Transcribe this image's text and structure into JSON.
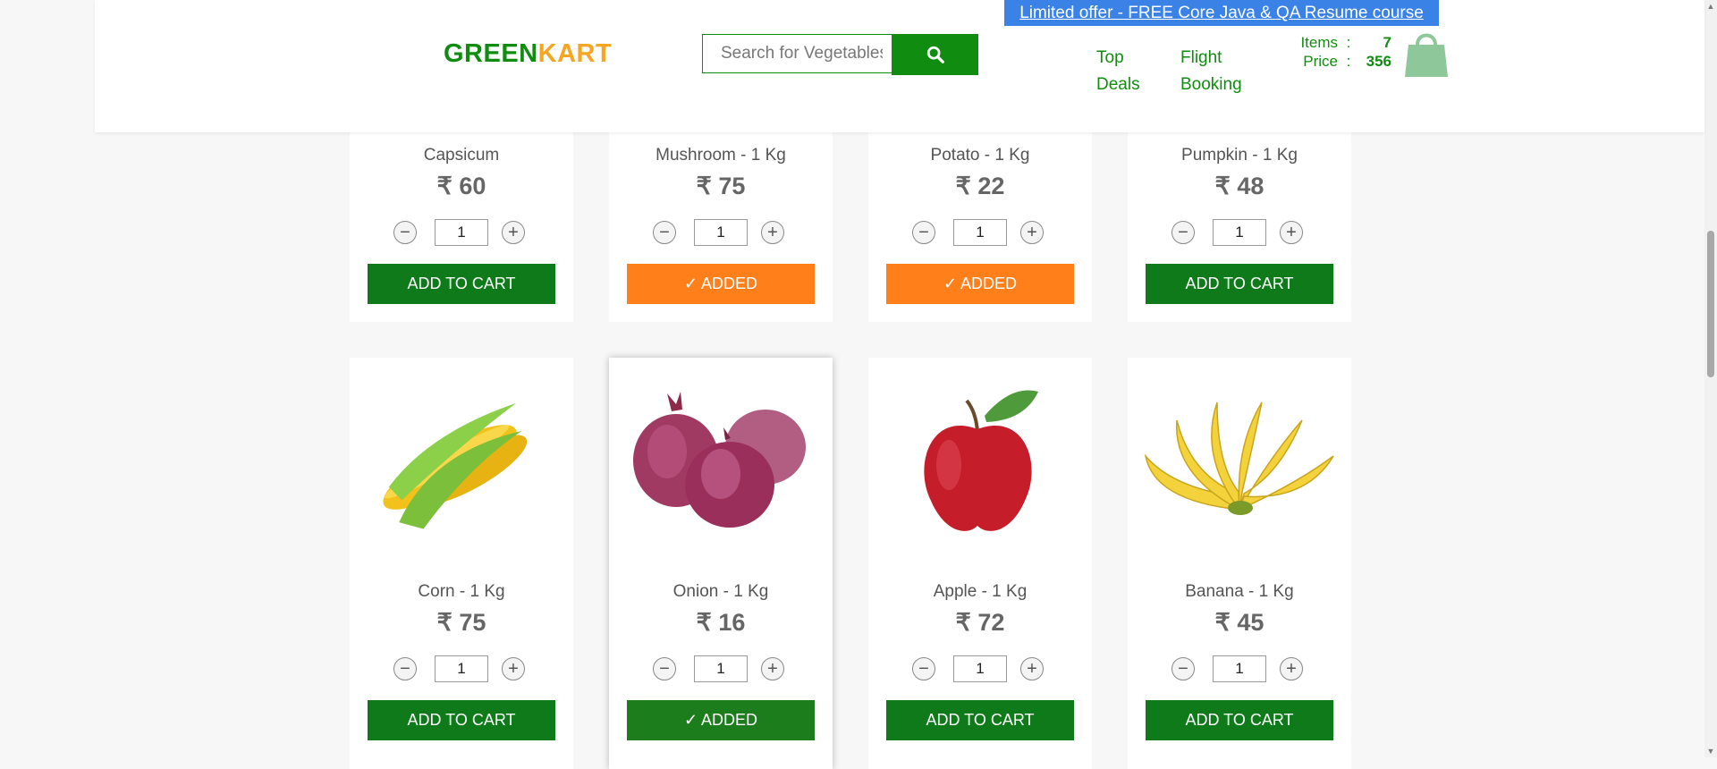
{
  "header": {
    "promo": "Limited offer - FREE Core Java & QA Resume course",
    "brand": {
      "part1": "GREEN",
      "part2": "KART"
    },
    "search_placeholder": "Search for Vegetables and Fruits",
    "nav": [
      {
        "line1": "Top",
        "line2": "Deals"
      },
      {
        "line1": "Flight",
        "line2": "Booking"
      }
    ],
    "cart": {
      "items_label": "Items",
      "items_value": "7",
      "price_label": "Price",
      "price_value": "356",
      "sep": ":"
    }
  },
  "currency": "₹",
  "products": [
    {
      "name": "Capsicum",
      "price": "₹ 60",
      "qty": "1",
      "button": "ADD TO CART",
      "state": "default"
    },
    {
      "name": "Mushroom - 1 Kg",
      "price": "₹ 75",
      "qty": "1",
      "button": "✓ ADDED",
      "state": "added"
    },
    {
      "name": "Potato - 1 Kg",
      "price": "₹ 22",
      "qty": "1",
      "button": "✓ ADDED",
      "state": "added"
    },
    {
      "name": "Pumpkin - 1 Kg",
      "price": "₹ 48",
      "qty": "1",
      "button": "ADD TO CART",
      "state": "default"
    },
    {
      "name": "Corn - 1 Kg",
      "price": "₹ 75",
      "qty": "1",
      "button": "ADD TO CART",
      "state": "default",
      "image": "corn"
    },
    {
      "name": "Onion - 1 Kg",
      "price": "₹ 16",
      "qty": "1",
      "button": "✓ ADDED",
      "state": "added-green",
      "image": "onion"
    },
    {
      "name": "Apple - 1 Kg",
      "price": "₹ 72",
      "qty": "1",
      "button": "ADD TO CART",
      "state": "default",
      "image": "apple"
    },
    {
      "name": "Banana - 1 Kg",
      "price": "₹ 45",
      "qty": "1",
      "button": "ADD TO CART",
      "state": "default",
      "image": "banana"
    }
  ],
  "stepper": {
    "minus": "−",
    "plus": "+"
  },
  "colors": {
    "brand_green": "#108d10",
    "brand_orange": "#f5a623",
    "added_orange": "#ff7f1a",
    "promo_blue": "#3b82e6"
  }
}
